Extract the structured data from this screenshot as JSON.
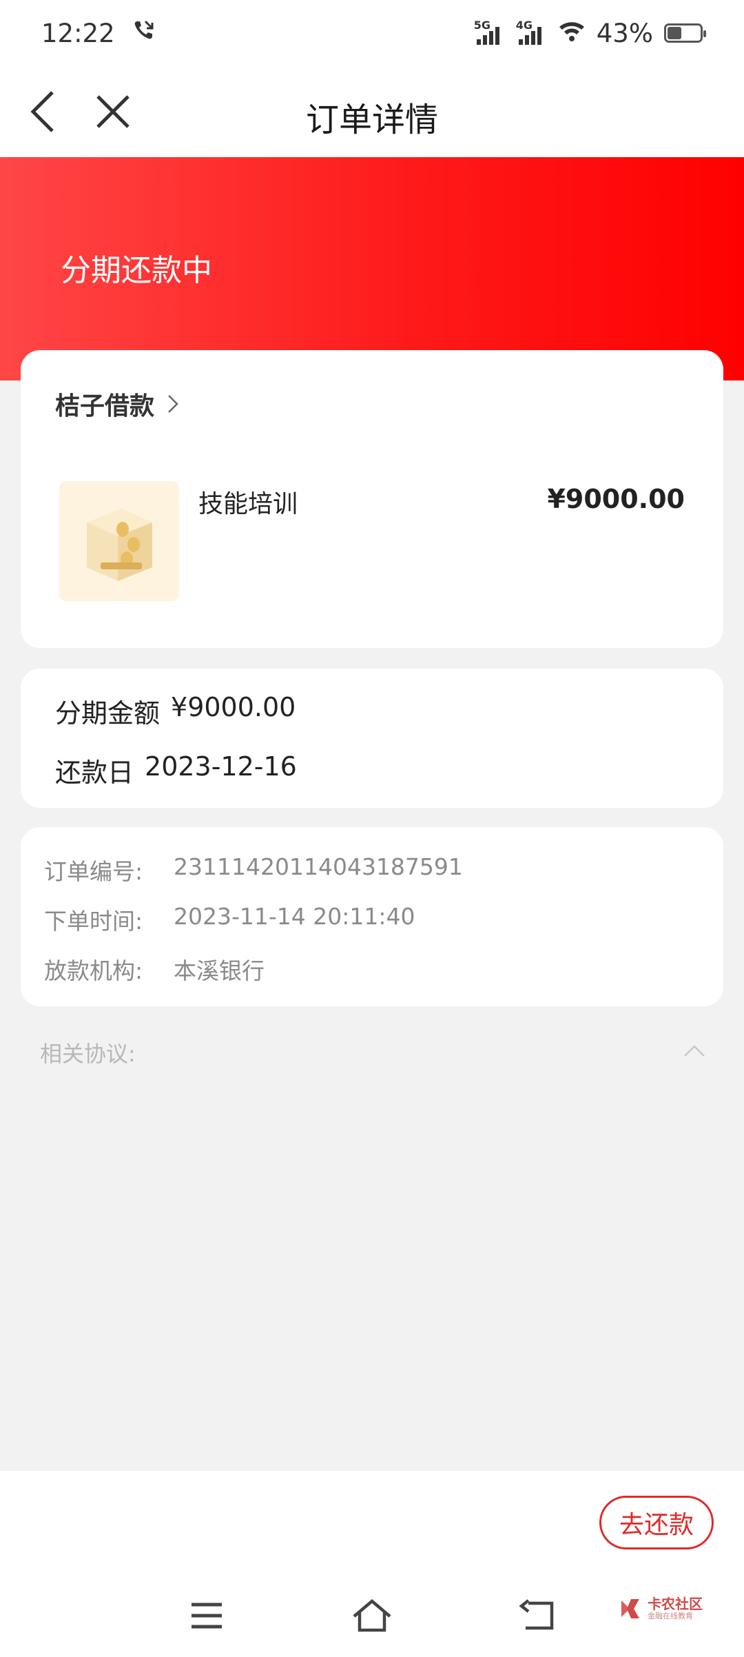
{
  "status_bar": {
    "time": "12:22",
    "signal1_label": "5G",
    "signal2_label": "4G",
    "battery": "43%",
    "battery_level": 0.43
  },
  "header": {
    "title": "订单详情"
  },
  "banner": {
    "status": "分期还款中"
  },
  "order_card": {
    "merchant": "桔子借款",
    "product_name": "技能培训",
    "product_price": "¥9000.00"
  },
  "installment": {
    "amount_label": "分期金额",
    "amount_value": "¥9000.00",
    "due_label": "还款日",
    "due_value": "2023-12-16"
  },
  "details": {
    "order_no_label": "订单编号:",
    "order_no_value": "231114201140431875​91",
    "order_time_label": "下单时间:",
    "order_time_value": "2023-11-14 20:11:40",
    "lender_label": "放款机构:",
    "lender_value": "本溪银行"
  },
  "agreements": {
    "label": "相关协议:"
  },
  "actions": {
    "repay_label": "去还款"
  },
  "watermark": {
    "name": "卡农社区",
    "sub": "金融在线教育"
  },
  "colors": {
    "accent_red": "#e02a2a",
    "banner_red": "#ff0000"
  }
}
